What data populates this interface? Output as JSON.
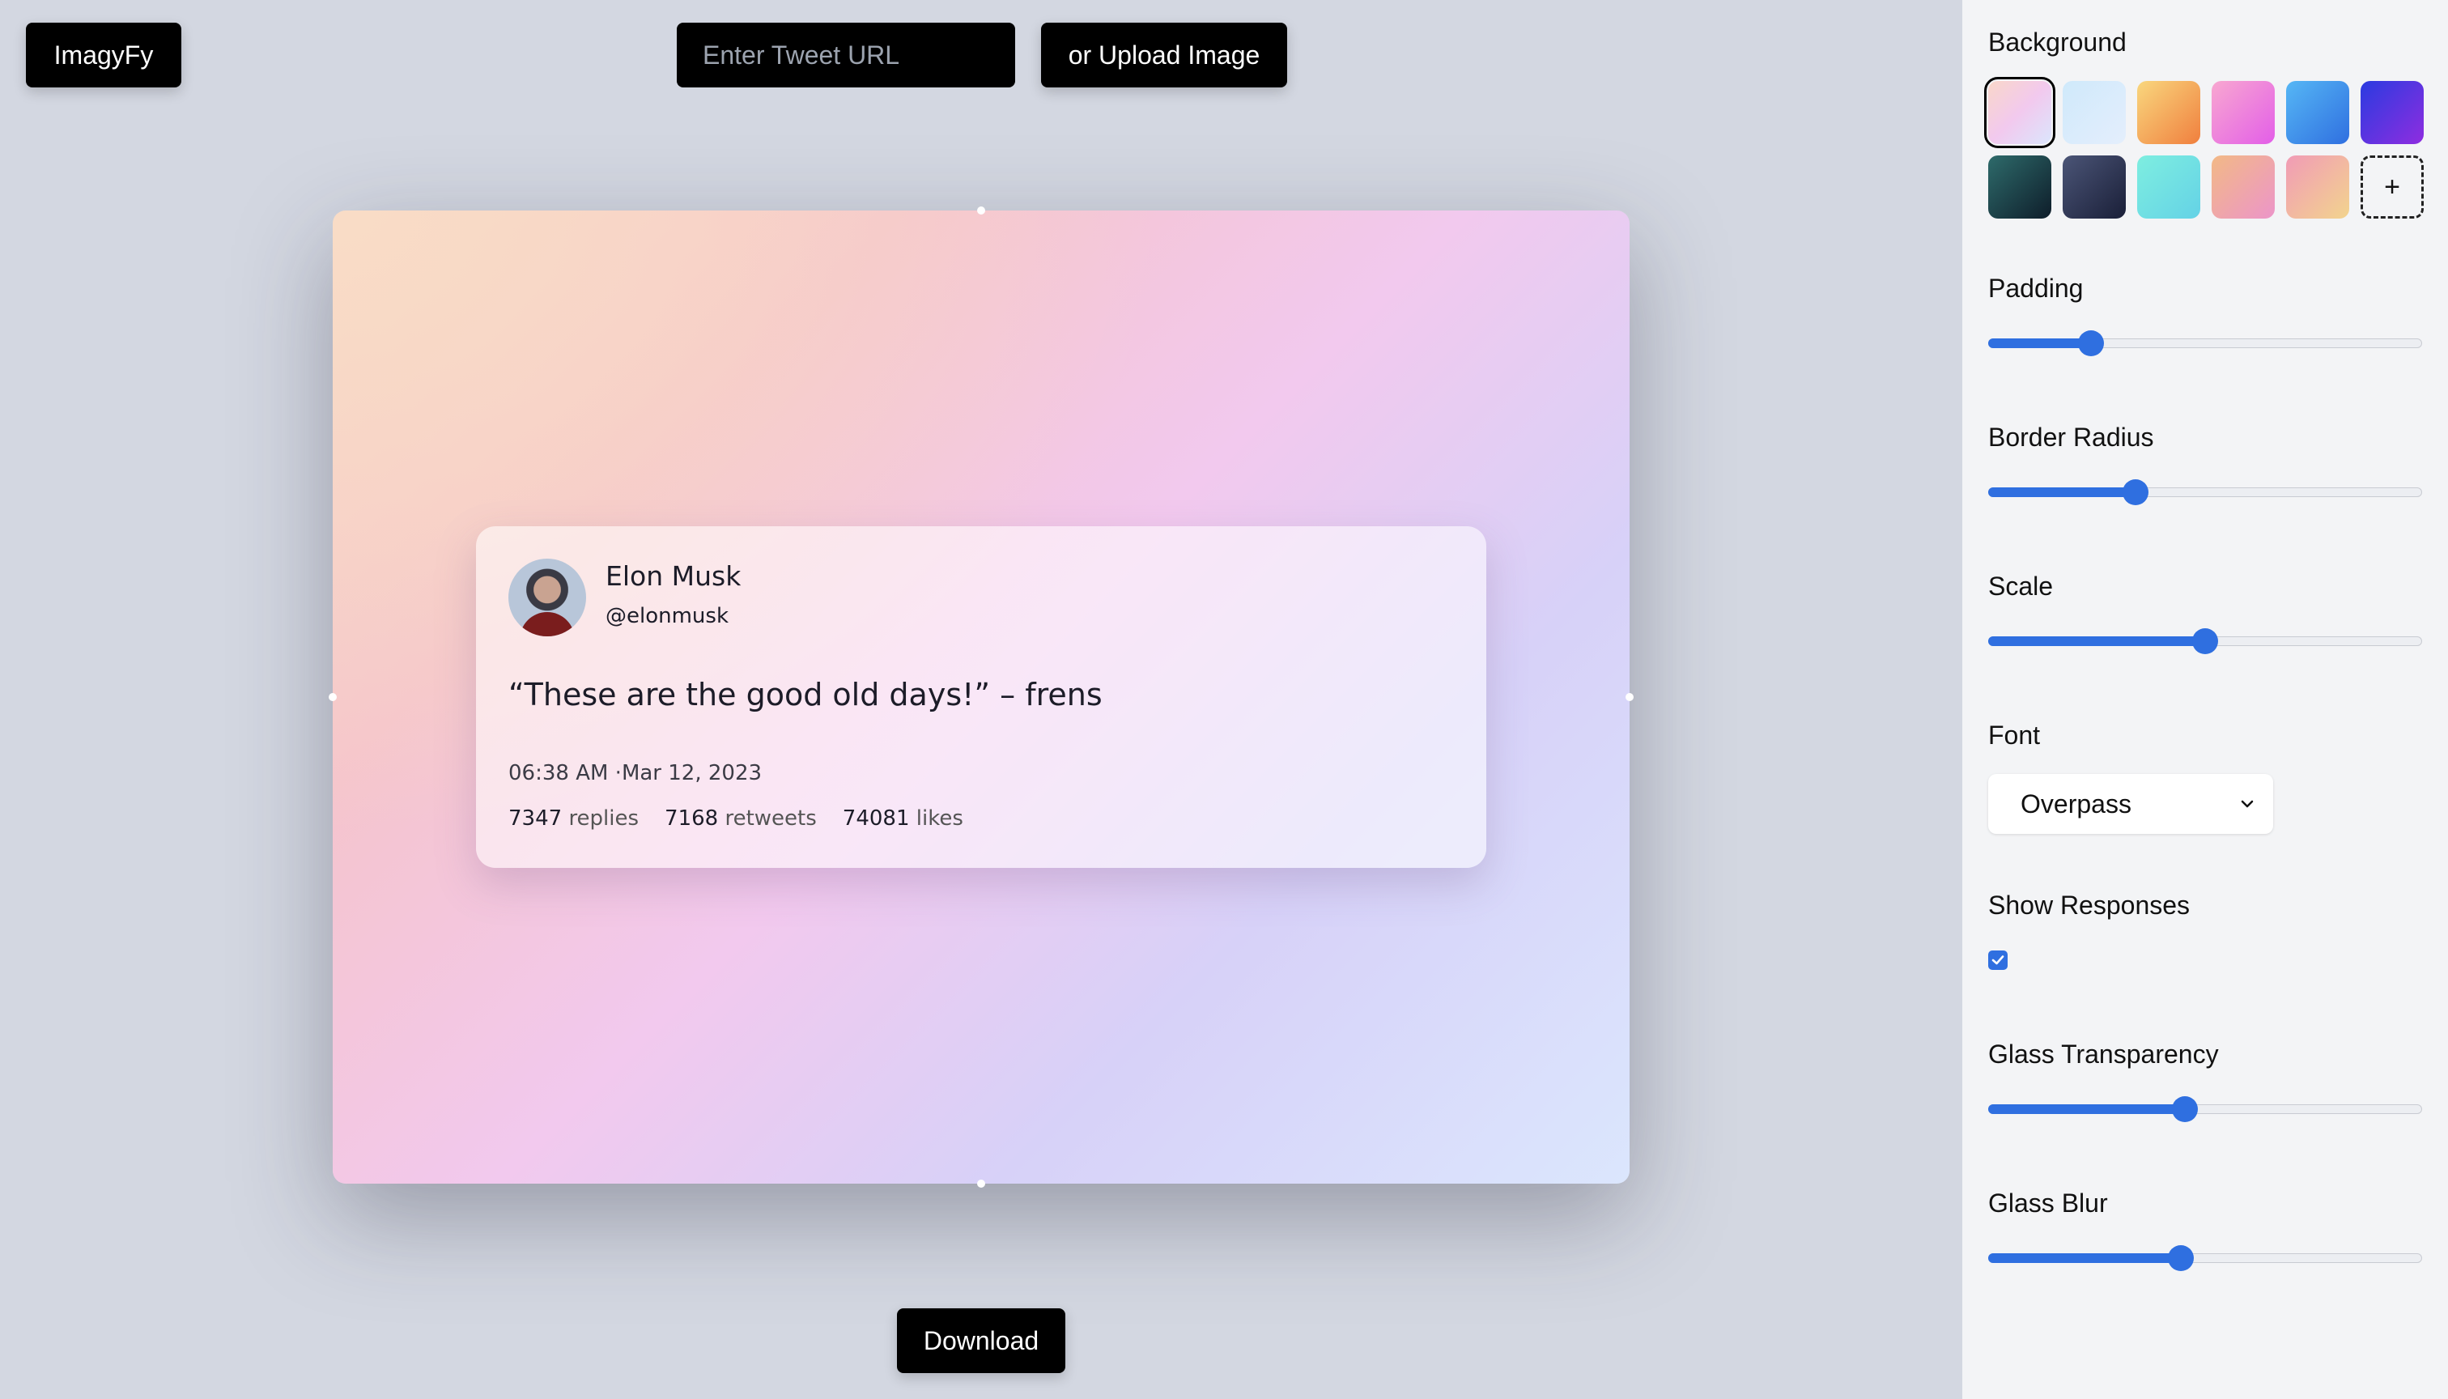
{
  "header": {
    "logo_label": "ImagyFy",
    "tweet_url_placeholder": "Enter Tweet URL",
    "upload_label": "or Upload Image"
  },
  "tweet": {
    "author_name": "Elon Musk",
    "author_handle": "@elonmusk",
    "text": "“These are the good old days!” – frens",
    "date": "06:38 AM ·Mar 12, 2023",
    "replies_count": "7347",
    "replies_label": "replies",
    "retweets_count": "7168",
    "retweets_label": "retweets",
    "likes_count": "74081",
    "likes_label": "likes"
  },
  "download_label": "Download",
  "sidebar": {
    "background_label": "Background",
    "swatches": [
      {
        "name": "peach-lavender",
        "colors": [
          "#f9d7c9",
          "#f2c9ee",
          "#dbe6fd"
        ],
        "selected": true
      },
      {
        "name": "sky-light",
        "colors": [
          "#cfe9fb",
          "#e4eefc"
        ]
      },
      {
        "name": "sunset-yellow",
        "colors": [
          "#f9d77e",
          "#f07f3e"
        ]
      },
      {
        "name": "pink-magenta",
        "colors": [
          "#f8a8d0",
          "#e35ee8"
        ]
      },
      {
        "name": "ocean-blue",
        "colors": [
          "#56b7f5",
          "#2f6fe0"
        ]
      },
      {
        "name": "indigo-violet",
        "colors": [
          "#2a3be0",
          "#8f2de0"
        ]
      },
      {
        "name": "dark-teal",
        "colors": [
          "#2e6b6b",
          "#0e1d2a"
        ]
      },
      {
        "name": "slate-navy",
        "colors": [
          "#4b5577",
          "#1a1f38"
        ]
      },
      {
        "name": "aqua-mint",
        "colors": [
          "#7eeee0",
          "#64d2e6"
        ]
      },
      {
        "name": "apricot-pink",
        "colors": [
          "#f2b986",
          "#ec95c9"
        ]
      },
      {
        "name": "rose-gold",
        "colors": [
          "#f19bb6",
          "#f2d48e"
        ]
      }
    ],
    "add_swatch_label": "+",
    "padding_label": "Padding",
    "padding_value": 0.22,
    "border_radius_label": "Border Radius",
    "border_radius_value": 0.33,
    "scale_label": "Scale",
    "scale_value": 0.5,
    "font_label": "Font",
    "font_value": "Overpass",
    "show_responses_label": "Show Responses",
    "show_responses_checked": true,
    "glass_transparency_label": "Glass Transparency",
    "glass_transparency_value": 0.45,
    "glass_blur_label": "Glass Blur",
    "glass_blur_value": 0.44
  },
  "colors": {
    "accent": "#2f6fe0",
    "button_bg": "#000000",
    "page_bg": "#d3d7e1",
    "sidebar_bg": "#f3f4f6"
  }
}
